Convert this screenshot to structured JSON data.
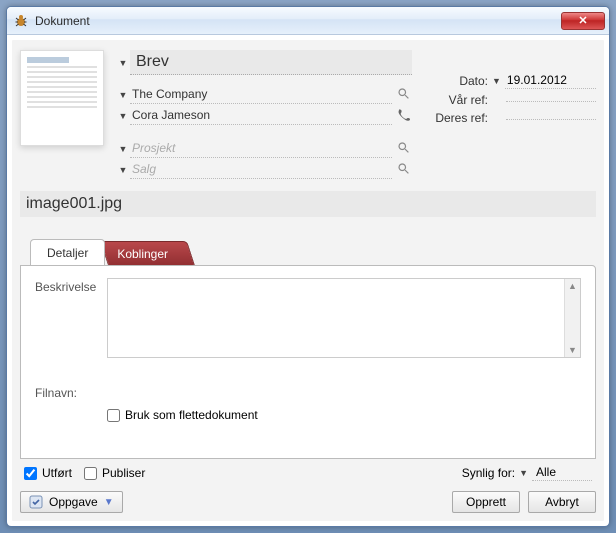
{
  "window": {
    "title": "Dokument",
    "close_glyph": "✕"
  },
  "doc": {
    "type": "Brev",
    "company": "The Company",
    "contact": "Cora Jameson",
    "project_placeholder": "Prosjekt",
    "sale_placeholder": "Salg",
    "file_title": "image001.jpg"
  },
  "meta": {
    "date_label": "Dato:",
    "date_value": "19.01.2012",
    "our_ref_label": "Vår ref:",
    "our_ref_value": "",
    "their_ref_label": "Deres ref:",
    "their_ref_value": ""
  },
  "tabs": {
    "details": "Detaljer",
    "links": "Koblinger"
  },
  "details": {
    "desc_label": "Beskrivelse",
    "filename_label": "Filnavn:",
    "merge_label": "Bruk som flettedokument",
    "merge_checked": false
  },
  "bottom": {
    "done_label": "Utført",
    "done_checked": true,
    "publish_label": "Publiser",
    "publish_checked": false,
    "visible_for_label": "Synlig for:",
    "visible_for_value": "Alle"
  },
  "footer": {
    "task_label": "Oppgave",
    "create_label": "Opprett",
    "cancel_label": "Avbryt"
  }
}
